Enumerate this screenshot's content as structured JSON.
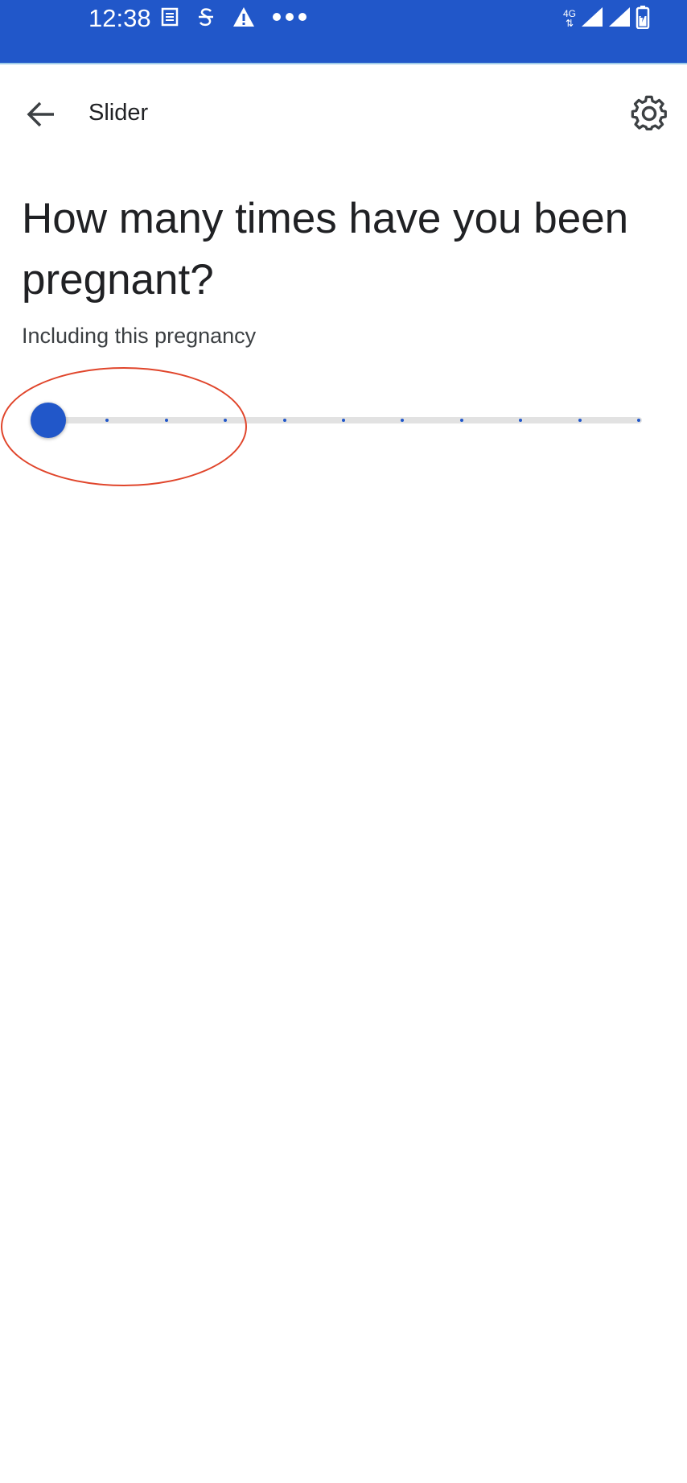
{
  "status_bar": {
    "time": "12:38",
    "network_type": "4G",
    "icons_left": [
      "news-icon",
      "strikethrough-s-icon",
      "warning-icon",
      "more-dots-icon"
    ],
    "icons_right": [
      "network-4g-icon",
      "signal-icon",
      "signal-icon",
      "battery-charging-icon"
    ],
    "background": "#2157c9"
  },
  "toolbar": {
    "title": "Slider",
    "back_icon": "arrow-back-icon",
    "settings_icon": "gear-icon"
  },
  "question": {
    "title": "How many times have you been pregnant?",
    "hint": "Including this pregnancy"
  },
  "slider": {
    "value": 0,
    "min": 0,
    "max": 10,
    "accent": "#2157c9",
    "track_color": "#e2e2e2"
  },
  "annotation": {
    "color": "#e0452b"
  }
}
